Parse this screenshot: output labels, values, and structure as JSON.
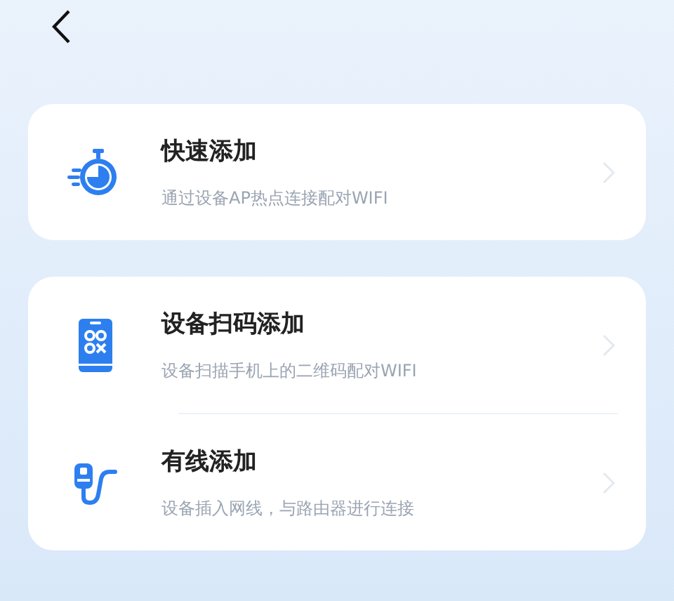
{
  "groups": [
    {
      "items": [
        {
          "kind": "stopwatch",
          "title": "快速添加",
          "subtitle": "通过设备AP热点连接配对WIFI"
        }
      ]
    },
    {
      "items": [
        {
          "kind": "qr-phone",
          "title": "设备扫码添加",
          "subtitle": "设备扫描手机上的二维码配对WIFI"
        },
        {
          "kind": "cable",
          "title": "有线添加",
          "subtitle": "设备插入网线，与路由器进行连接"
        }
      ]
    }
  ]
}
